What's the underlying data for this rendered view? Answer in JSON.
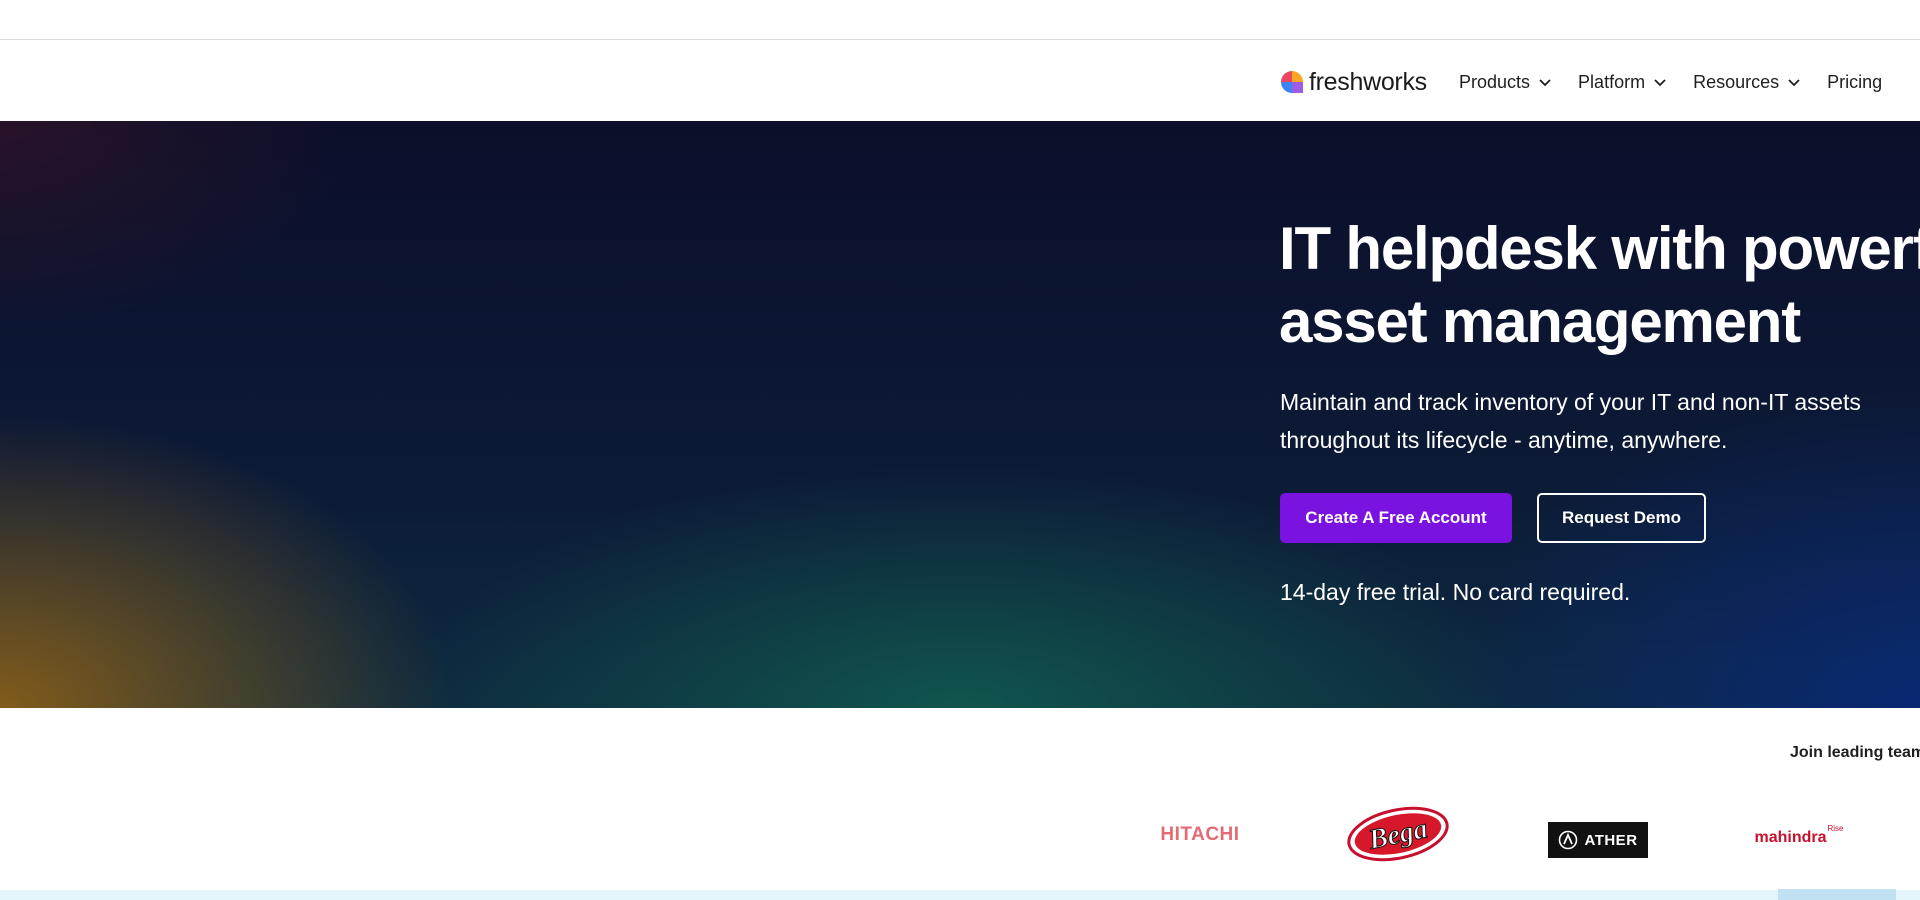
{
  "header": {
    "logo_text": "freshworks",
    "nav": [
      {
        "label": "Products",
        "has_dropdown": true
      },
      {
        "label": "Platform",
        "has_dropdown": true
      },
      {
        "label": "Resources",
        "has_dropdown": true
      },
      {
        "label": "Pricing",
        "has_dropdown": false
      }
    ]
  },
  "hero": {
    "title": "IT helpdesk with powerfu\nasset management",
    "subtitle": "Maintain and track inventory of your IT and non-IT assets throughout its lifecycle - anytime, anywhere.",
    "primary_button": "Create A Free Account",
    "secondary_button": "Request Demo",
    "trial_note": "14-day free trial. No card required."
  },
  "logos": {
    "heading": "Join leading team",
    "brands": [
      {
        "name": "HITACHI"
      },
      {
        "name": "Bega"
      },
      {
        "name": "ATHER"
      },
      {
        "name": "mahindra",
        "superscript": "Rise"
      }
    ]
  },
  "colors": {
    "accent": "#7a13e0",
    "hero_dark": "#0b0f2a",
    "bottom_band": "#e4f4fb"
  },
  "icons": {
    "dropdown": "chevron-down-icon",
    "logo": "freshworks-logo-icon"
  }
}
